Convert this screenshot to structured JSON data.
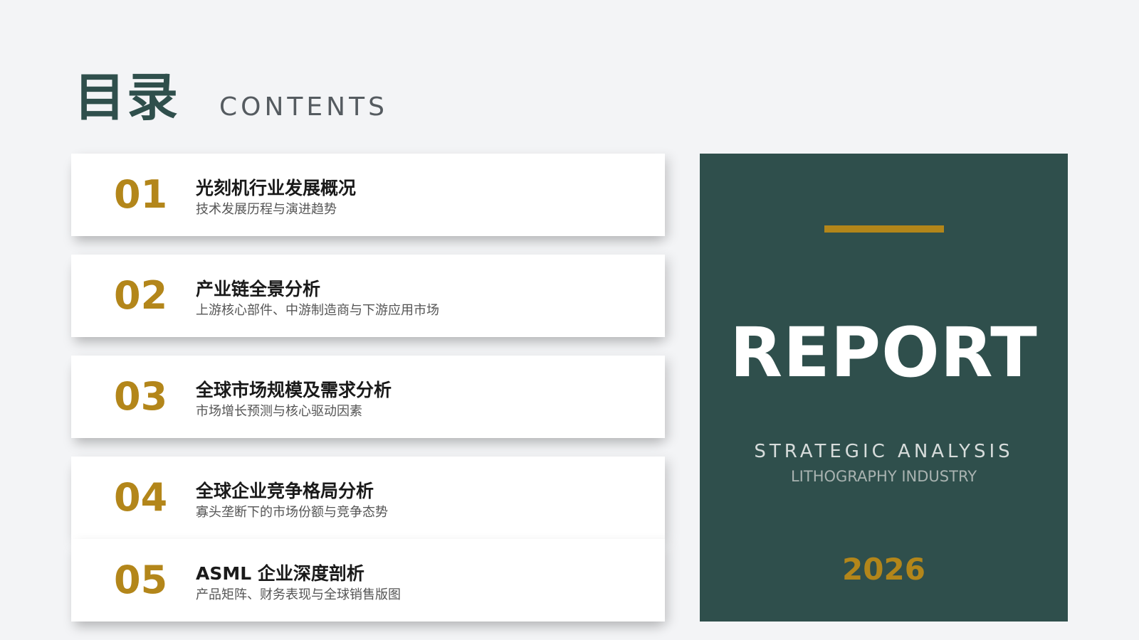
{
  "header": {
    "title_cn": "目录",
    "title_en": "CONTENTS"
  },
  "toc": [
    {
      "num": "01",
      "title": "光刻机行业发展概况",
      "subtitle": "技术发展历程与演进趋势"
    },
    {
      "num": "02",
      "title": "产业链全景分析",
      "subtitle": "上游核心部件、中游制造商与下游应用市场"
    },
    {
      "num": "03",
      "title": "全球市场规模及需求分析",
      "subtitle": "市场增长预测与核心驱动因素"
    },
    {
      "num": "04",
      "title": "全球企业竞争格局分析",
      "subtitle": "寡头垄断下的市场份额与竞争态势"
    },
    {
      "num": "05",
      "title": "ASML 企业深度剖析",
      "subtitle": "产品矩阵、财务表现与全球销售版图"
    }
  ],
  "report_card": {
    "word": "REPORT",
    "line1": "STRATEGIC ANALYSIS",
    "line2": "LITHOGRAPHY INDUSTRY",
    "year": "2026"
  },
  "colors": {
    "background": "#f3f4f6",
    "dark_green": "#2f4f4c",
    "gold": "#b3861a"
  }
}
